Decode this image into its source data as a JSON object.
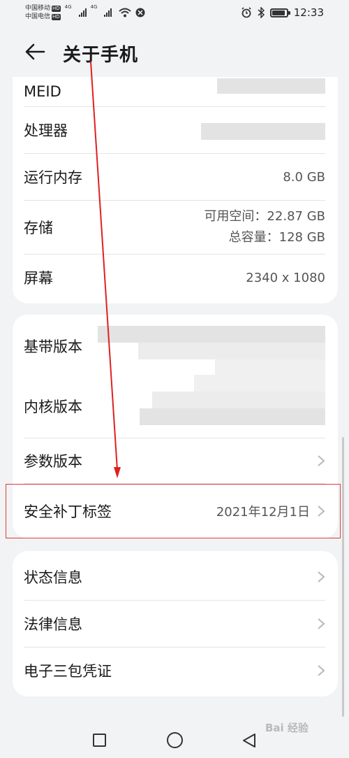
{
  "status_bar": {
    "carrier1": "中国移动",
    "carrier2": "中国电信",
    "hd": "HD",
    "network": "4G",
    "time": "12:33"
  },
  "header": {
    "title": "关于手机"
  },
  "card1": {
    "meid_label": "MEID",
    "processor_label": "处理器",
    "ram_label": "运行内存",
    "ram_value": "8.0 GB",
    "storage_label": "存储",
    "storage_available": "可用空间：22.87  GB",
    "storage_total": "总容量：128  GB",
    "screen_label": "屏幕",
    "screen_value": "2340 x 1080"
  },
  "card2": {
    "baseband_label": "基带版本",
    "kernel_label": "内核版本",
    "param_label": "参数版本",
    "patch_label": "安全补丁标签",
    "patch_value": "2021年12月1日"
  },
  "card3": {
    "status_label": "状态信息",
    "legal_label": "法律信息",
    "warranty_label": "电子三包凭证"
  },
  "watermark": "Bai 经验",
  "colors": {
    "background": "#f1f3f5",
    "card": "#ffffff",
    "highlight": "#e23b3b",
    "arrow": "#e02020"
  }
}
